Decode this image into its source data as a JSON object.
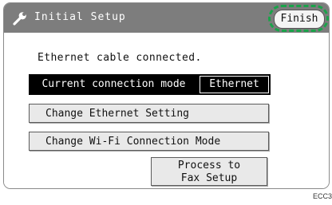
{
  "window": {
    "title": "Initial Setup",
    "title_icon": "wrench-icon",
    "finish_label": "Finish"
  },
  "status": {
    "message": "Ethernet cable connected."
  },
  "connection_mode": {
    "label": "Current connection mode",
    "value": "Ethernet"
  },
  "buttons": {
    "change_ethernet": "Change Ethernet Setting",
    "change_wifi": "Change Wi-Fi Connection Mode",
    "fax_setup_line1": "Process to",
    "fax_setup_line2": "Fax Setup"
  },
  "figure_code": "ECC3",
  "colors": {
    "titlebar": "#7d7d7d",
    "highlight": "#1aa34a",
    "mode_row": "#000000",
    "button": "#e9e9e9"
  }
}
